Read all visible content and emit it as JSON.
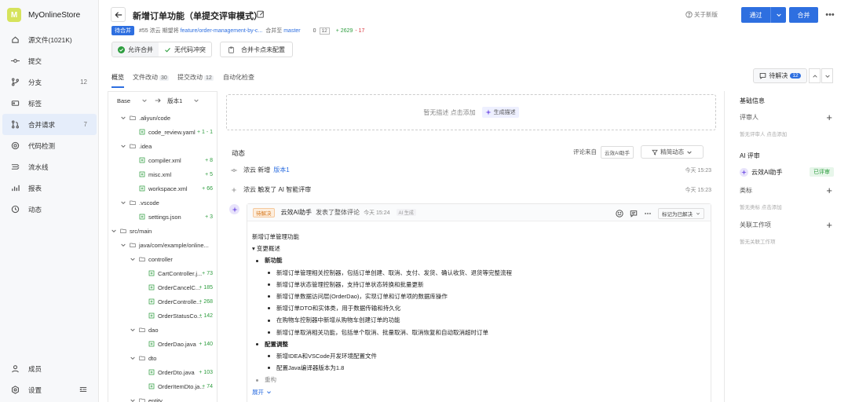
{
  "sidebar": {
    "brand_initial": "M",
    "brand_name": "MyOnlineStore",
    "items": [
      {
        "label": "源文件(1021K)",
        "count": ""
      },
      {
        "label": "提交",
        "count": ""
      },
      {
        "label": "分支",
        "count": "12"
      },
      {
        "label": "标签",
        "count": ""
      },
      {
        "label": "合并请求",
        "count": "7"
      },
      {
        "label": "代码检测",
        "count": ""
      },
      {
        "label": "流水线",
        "count": ""
      },
      {
        "label": "报表",
        "count": ""
      },
      {
        "label": "动态",
        "count": ""
      }
    ],
    "bottom": [
      {
        "label": "成员"
      },
      {
        "label": "设置"
      }
    ]
  },
  "header": {
    "title": "新增订单功能（单提交评审模式）",
    "status": "待合并",
    "mr_id": "#55",
    "author": "浓云",
    "action": "期望将",
    "source_branch": "feature/order-management-by-c...",
    "merge_into": "合并至",
    "target_branch": "master",
    "files_a": "0",
    "files_b": "12",
    "additions": "+ 2629",
    "deletions": "- 17",
    "help": "关于新版",
    "approve_label": "通过",
    "merge_label": "合并",
    "checks": [
      {
        "label": "允许合并"
      },
      {
        "label": "无代码冲突"
      }
    ],
    "merge_card": "合并卡点未配置"
  },
  "tabs": [
    {
      "label": "概览",
      "count": ""
    },
    {
      "label": "文件改动",
      "count": "30"
    },
    {
      "label": "提交改动",
      "count": "12"
    },
    {
      "label": "自动化检查",
      "count": ""
    }
  ],
  "pending": {
    "label": "待解决",
    "count": "12"
  },
  "tree": {
    "base": "Base",
    "version": "版本1",
    "rows": [
      {
        "label": ".aliyun/code",
        "delta": ""
      },
      {
        "label": "code_review.yaml",
        "delta": "+ 1  - 1"
      },
      {
        "label": ".idea",
        "delta": ""
      },
      {
        "label": "compiler.xml",
        "delta": "+ 8"
      },
      {
        "label": "misc.xml",
        "delta": "+ 5"
      },
      {
        "label": "workspace.xml",
        "delta": "+ 66"
      },
      {
        "label": ".vscode",
        "delta": ""
      },
      {
        "label": "settings.json",
        "delta": "+ 3"
      },
      {
        "label": "src/main",
        "delta": ""
      },
      {
        "label": "java/com/example/online...",
        "delta": ""
      },
      {
        "label": "controller",
        "delta": ""
      },
      {
        "label": "CartController.j...",
        "delta": "+ 73"
      },
      {
        "label": "OrderCancelC...",
        "delta": "+ 185"
      },
      {
        "label": "OrderControlle...",
        "delta": "+ 268"
      },
      {
        "label": "OrderStatusCo...",
        "delta": "+ 142"
      },
      {
        "label": "dao",
        "delta": ""
      },
      {
        "label": "OrderDao.java",
        "delta": "+ 140"
      },
      {
        "label": "dto",
        "delta": ""
      },
      {
        "label": "OrderDto.java",
        "delta": "+ 103"
      },
      {
        "label": "OrderItemDto.ja...",
        "delta": "+ 74"
      },
      {
        "label": "entity",
        "delta": ""
      }
    ]
  },
  "main": {
    "desc_empty": "暂无描述 点击添加",
    "gen_desc": "生成描述",
    "activity_title": "动态",
    "comment_from": "评论来自",
    "comment_source": "云效AI助手",
    "filter_label": "精简动态",
    "events": [
      {
        "user": "浓云",
        "action": "新增",
        "link": "版本1",
        "time": "今天 15:23"
      },
      {
        "user": "浓云",
        "action": "触发了 AI 智能评审",
        "link": "",
        "time": "今天 15:23"
      }
    ],
    "comment": {
      "tag": "待解决",
      "who": "云效AI助手",
      "what": "发表了整体评论",
      "time": "今天 15:24",
      "ai_tag": "AI 生成",
      "mark": "标记为已解决",
      "title": "新增订单管理功能",
      "summary": "▾ 变更概述",
      "sec1": "新功能",
      "items1": [
        "新增订单管理相关控制器，包括订单创建、取消、支付、发货、确认收货、退货等完整流程",
        "新增订单状态管理控制器，支持订单状态转换和批量更新",
        "新增订单数据访问层(OrderDao)，实现订单和订单项的数据库操作",
        "新增订单DTO和实体类，用于数据传输和持久化",
        "在购物车控制器中新增从购物车创建订单的功能",
        "新增订单取消相关功能，包括单个取消、批量取消、取消恢复和自动取消超时订单"
      ],
      "sec2": "配置调整",
      "items2": [
        "新增IDEA和VSCode开发环境配置文件",
        "配置Java编译器版本为1.8"
      ],
      "sec3": "重构",
      "expand": "展开"
    }
  },
  "right": {
    "basic_info": "基础信息",
    "reviewers": "评审人",
    "reviewers_empty": "暂无评审人 点击添加",
    "ai_review": "AI 评审",
    "ai_name": "云效AI助手",
    "ai_status": "已评审",
    "labels": "类标",
    "labels_empty": "暂无类标 点击添加",
    "work_items": "关联工作项",
    "work_items_empty": "暂无关联工作项"
  },
  "colors": {
    "accent": "#2e6fe0",
    "add": "#2d9d3e",
    "del": "#d9363e",
    "pending": "#d5781f",
    "logo": "#d6e35c"
  }
}
